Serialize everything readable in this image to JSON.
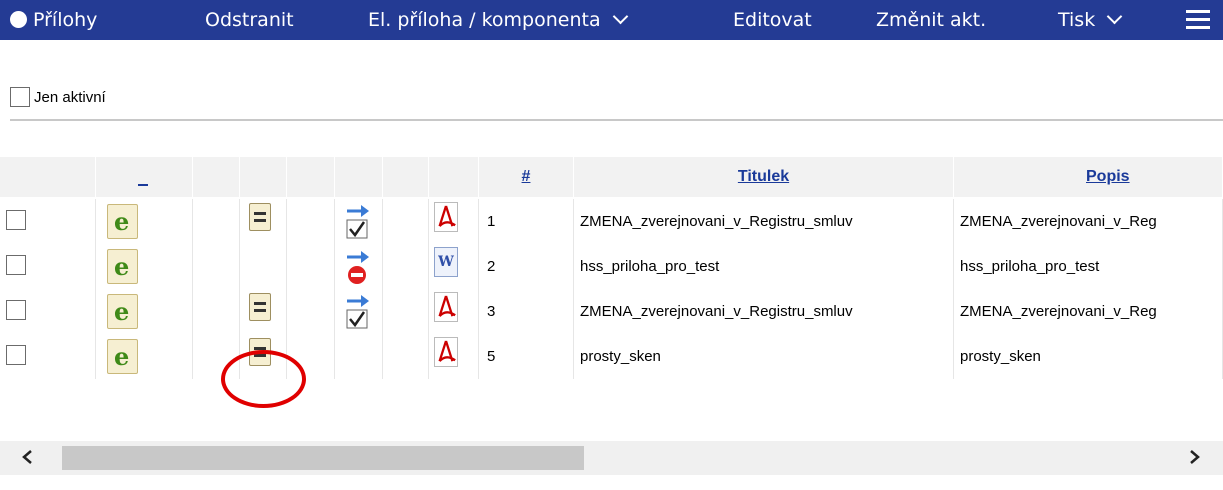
{
  "toolbar": {
    "title": "Přílohy",
    "remove": "Odstranit",
    "attachment_menu": "El. příloha / komponenta",
    "edit": "Editovat",
    "change_current": "Změnit akt.",
    "print": "Tisk"
  },
  "filter": {
    "only_active_label": "Jen aktivní"
  },
  "grid": {
    "headers": {
      "sort_col": "_",
      "number": "#",
      "title": "Titulek",
      "description": "Popis"
    },
    "rows": [
      {
        "number": "1",
        "title": "ZMENA_zverejnovani_v_Registru_smluv",
        "description": "ZMENA_zverejnovani_v_Reg",
        "has_doc_icon": true,
        "status_icon": "transfer-check-icon",
        "file_icon": "pdf-icon"
      },
      {
        "number": "2",
        "title": "hss_priloha_pro_test",
        "description": "hss_priloha_pro_test",
        "has_doc_icon": false,
        "status_icon": "transfer-stop-icon",
        "file_icon": "word-icon"
      },
      {
        "number": "3",
        "title": "ZMENA_zverejnovani_v_Registru_smluv",
        "description": "ZMENA_zverejnovani_v_Reg",
        "has_doc_icon": true,
        "status_icon": "transfer-check-icon",
        "file_icon": "pdf-icon"
      },
      {
        "number": "5",
        "title": "prosty_sken",
        "description": "prosty_sken",
        "has_doc_icon": true,
        "status_icon": "",
        "file_icon": "pdf-icon"
      }
    ]
  },
  "colors": {
    "toolbar_bg": "#243b94",
    "link": "#1a3a9a",
    "annotation": "#e00000"
  }
}
